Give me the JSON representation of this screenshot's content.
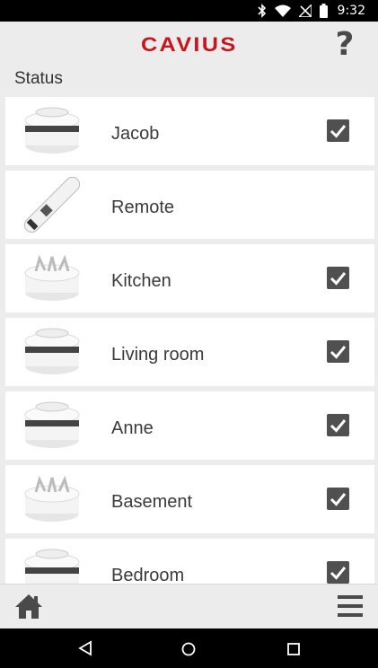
{
  "status_bar": {
    "time": "9:32",
    "icons": [
      "bluetooth-icon",
      "wifi-icon",
      "no-signal-icon",
      "battery-icon"
    ]
  },
  "header": {
    "logo_text": "CAVIUS",
    "help_label": "?",
    "brand_color": "#c8141c"
  },
  "section_title": "Status",
  "devices": [
    {
      "name": "Jacob",
      "icon": "smoke-detector-icon",
      "checked": true
    },
    {
      "name": "Remote",
      "icon": "remote-icon",
      "checked": false
    },
    {
      "name": "Kitchen",
      "icon": "heat-detector-icon",
      "checked": true
    },
    {
      "name": "Living room",
      "icon": "smoke-detector-icon",
      "checked": true
    },
    {
      "name": "Anne",
      "icon": "smoke-detector-icon",
      "checked": true
    },
    {
      "name": "Basement",
      "icon": "heat-detector-icon",
      "checked": true
    },
    {
      "name": "Bedroom",
      "icon": "smoke-detector-icon",
      "checked": true
    }
  ],
  "bottom_nav": {
    "home_icon": "home-icon",
    "menu_icon": "hamburger-menu-icon"
  },
  "android_nav": [
    "back-icon",
    "home-circle-icon",
    "recents-icon"
  ]
}
